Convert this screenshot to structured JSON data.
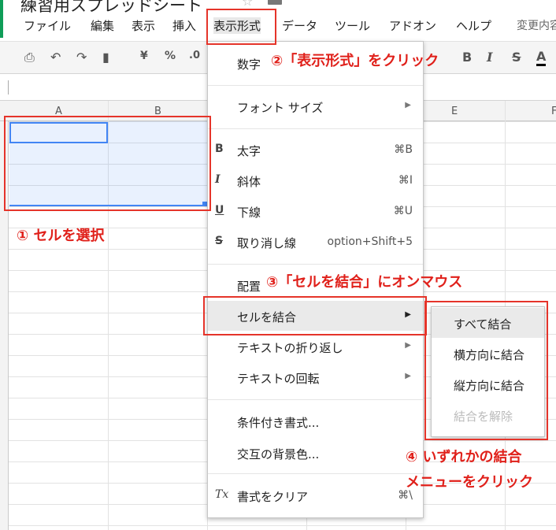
{
  "app": {
    "title": "練習用スプレッドシート",
    "last_edit": "変更内容"
  },
  "menubar": {
    "items": [
      "ファイル",
      "編集",
      "表示",
      "挿入",
      "表示形式",
      "データ",
      "ツール",
      "アドオン",
      "ヘルプ"
    ],
    "active": "表示形式"
  },
  "toolbar": {
    "icons": [
      "print-icon",
      "undo-icon",
      "redo-icon",
      "paint-format-icon"
    ],
    "currency": "¥",
    "percent": "%",
    "decimal": ".0",
    "bold": "B",
    "italic": "I",
    "strike": "S",
    "text_color": "A"
  },
  "columns": [
    "A",
    "B",
    "E",
    "F"
  ],
  "format_menu": {
    "items": [
      {
        "label": "数字",
        "icon": "",
        "shortcut": "",
        "submenu": true
      },
      {
        "label": "フォント サイズ",
        "icon": "",
        "shortcut": "",
        "submenu": true
      },
      {
        "label": "太字",
        "icon": "B",
        "shortcut": "⌘B",
        "submenu": false
      },
      {
        "label": "斜体",
        "icon": "I",
        "shortcut": "⌘I",
        "submenu": false
      },
      {
        "label": "下線",
        "icon": "U",
        "shortcut": "⌘U",
        "submenu": false
      },
      {
        "label": "取り消し線",
        "icon": "S",
        "shortcut": "option+Shift+5",
        "submenu": false
      },
      {
        "label": "配置",
        "icon": "",
        "shortcut": "",
        "submenu": true
      },
      {
        "label": "セルを結合",
        "icon": "",
        "shortcut": "",
        "submenu": true
      },
      {
        "label": "テキストの折り返し",
        "icon": "",
        "shortcut": "",
        "submenu": true
      },
      {
        "label": "テキストの回転",
        "icon": "",
        "shortcut": "",
        "submenu": true
      },
      {
        "label": "条件付き書式...",
        "icon": "",
        "shortcut": "",
        "submenu": false
      },
      {
        "label": "交互の背景色...",
        "icon": "",
        "shortcut": "",
        "submenu": false
      },
      {
        "label": "書式をクリア",
        "icon": "Tx",
        "shortcut": "⌘\\",
        "submenu": false
      }
    ],
    "submenu_arrow": "▶"
  },
  "merge_submenu": {
    "items": [
      {
        "label": "すべて結合",
        "enabled": true
      },
      {
        "label": "横方向に結合",
        "enabled": true
      },
      {
        "label": "縦方向に結合",
        "enabled": true
      },
      {
        "label": "結合を解除",
        "enabled": false
      }
    ]
  },
  "annotations": {
    "step1": "① セルを選択",
    "step2": "②「表示形式」をクリック",
    "step3": "③「セルを結合」にオンマウス",
    "step4_line1": "④ いずれかの結合",
    "step4_line2": "メニューをクリック"
  },
  "colors": {
    "annotation_red": "#e0201a",
    "selection_blue": "#4285f4",
    "sheets_green": "#0f9d58"
  }
}
